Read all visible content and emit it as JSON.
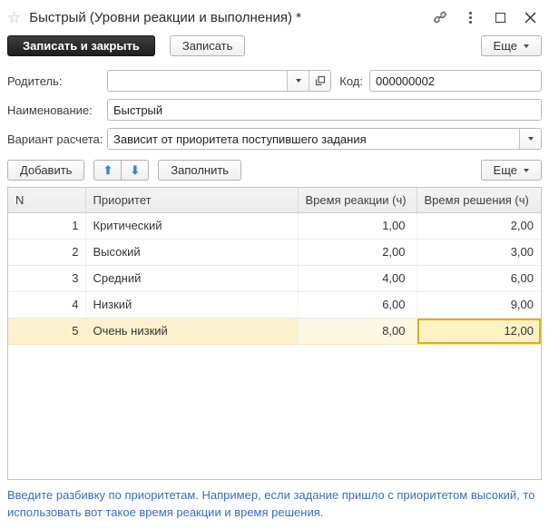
{
  "window": {
    "title": "Быстрый (Уровни реакции и выполнения) *",
    "icons": {
      "favorite": "star",
      "link": "chain",
      "more": "kebab",
      "maximize": "square",
      "close": "x"
    }
  },
  "commandbar": {
    "save_close_label": "Записать и закрыть",
    "save_label": "Записать",
    "more_label": "Еще"
  },
  "fields": {
    "parent": {
      "label": "Родитель:",
      "value": ""
    },
    "code": {
      "label": "Код:",
      "value": "000000002"
    },
    "name": {
      "label": "Наименование:",
      "value": "Быстрый"
    },
    "variant": {
      "label": "Вариант расчета:",
      "value": "Зависит от приоритета поступившего задания"
    }
  },
  "table_toolbar": {
    "add_label": "Добавить",
    "move_up_icon": "⬆",
    "move_down_icon": "⬇",
    "fill_label": "Заполнить",
    "more_label": "Еще"
  },
  "table": {
    "headers": [
      "N",
      "Приоритет",
      "Время реакции (ч)",
      "Время решения (ч)"
    ],
    "rows": [
      {
        "num": "1",
        "priority": "Критический",
        "reaction": "1,00",
        "resolution": "2,00"
      },
      {
        "num": "2",
        "priority": "Высокий",
        "reaction": "2,00",
        "resolution": "3,00"
      },
      {
        "num": "3",
        "priority": "Средний",
        "reaction": "4,00",
        "resolution": "6,00"
      },
      {
        "num": "4",
        "priority": "Низкий",
        "reaction": "6,00",
        "resolution": "9,00"
      },
      {
        "num": "5",
        "priority": "Очень низкий",
        "reaction": "8,00",
        "resolution": "12,00"
      }
    ],
    "selected_row": 5,
    "selected_cell_value": "12,00"
  },
  "hint": "Введите разбивку по приоритетам. Например, если задание пришло с приоритетом высокий, то использовать вот такое время реакции и время решения.",
  "colors": {
    "selected_row_bg": "#fbf1cd",
    "selected_cell_border": "#e5ad10",
    "hint_text": "#3a6dbf",
    "primary_button_bg": "#2b2b2b",
    "arrow_icon_blue": "#2e8ad0"
  }
}
